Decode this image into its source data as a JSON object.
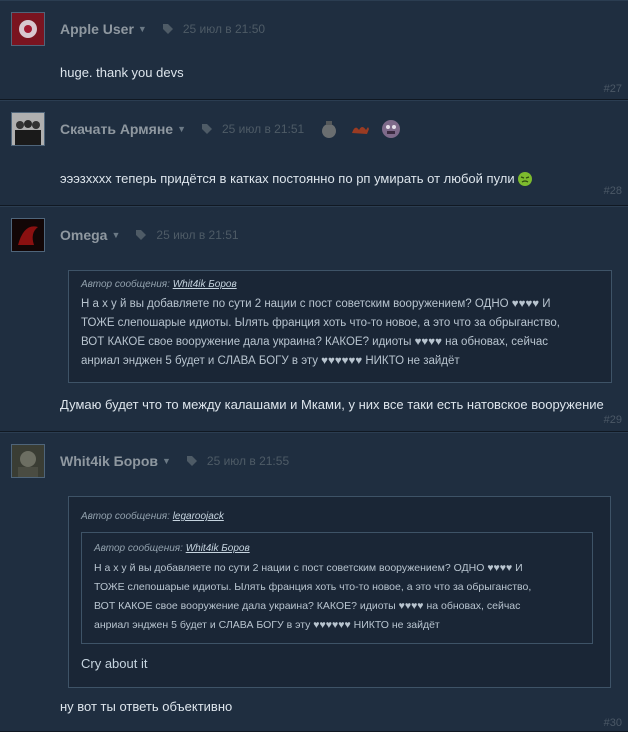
{
  "colors": {
    "page_bg": "#1b2838",
    "post_bg": "#1f2e40",
    "author": "#8f98a0",
    "muted": "#4e5b66"
  },
  "posts": [
    {
      "author": "Apple User",
      "date": "25 июл в 21:50",
      "text": "huge. thank you devs",
      "number": "#27",
      "avatar_icon": "flower-avatar-icon"
    },
    {
      "author": "Скачать Армяне",
      "date": "25 июл в 21:51",
      "text": "эээзхххх теперь придётся в катках постоянно по рп умирать от любой пули",
      "number": "#28",
      "avatar_icon": "group-photo-avatar-icon",
      "awards": [
        "money-bag-award-icon",
        "camel-award-icon",
        "monster-face-award-icon"
      ]
    },
    {
      "author": "Omega",
      "date": "25 июл в 21:51",
      "quote": {
        "prefix": "Автор сообщения:",
        "author": "Whit4ik Боров",
        "lines": [
          "Н а х у й вы добавляете по сути 2 нации с пост советским вооружением? ОДНО ♥♥♥♥ И",
          "ТОЖЕ слепошарые идиоты. Ылять франция хоть что-то новое, а это что за обрыганство,",
          "ВОТ КАКОЕ свое вооружение дала украина? КАКОЕ? идиоты ♥♥♥♥ на обновах, сейчас",
          "анриал энджен 5 будет и СЛАВА БОГУ в эту ♥♥♥♥♥♥ НИКТО не зайдёт"
        ]
      },
      "text": "Думаю будет что то между калашами и Мками, у них все таки есть натовское вооружение",
      "number": "#29",
      "avatar_icon": "dragon-avatar-icon"
    },
    {
      "author": "Whit4ik Боров",
      "date": "25 июл в 21:55",
      "quote": {
        "prefix": "Автор сообщения:",
        "author": "legaroojack",
        "inner": {
          "prefix": "Автор сообщения:",
          "author": "Whit4ik Боров",
          "lines": [
            "Н а х у й вы добавляете по сути 2 нации с пост советским вооружением? ОДНО ♥♥♥♥ И",
            "ТОЖЕ слепошарые идиоты. Ылять франция хоть что-то новое, а это что за обрыганство,",
            "ВОТ КАКОЕ свое вооружение дала украина? КАКОЕ? идиоты ♥♥♥♥ на обновах, сейчас",
            "анриал энджен 5 будет и СЛАВА БОГУ в эту ♥♥♥♥♥♥ НИКТО не зайдёт"
          ]
        },
        "reply": "Cry about it"
      },
      "text": "ну вот ты ответь объективно",
      "number": "#30",
      "avatar_icon": "soldier-avatar-icon"
    }
  ]
}
